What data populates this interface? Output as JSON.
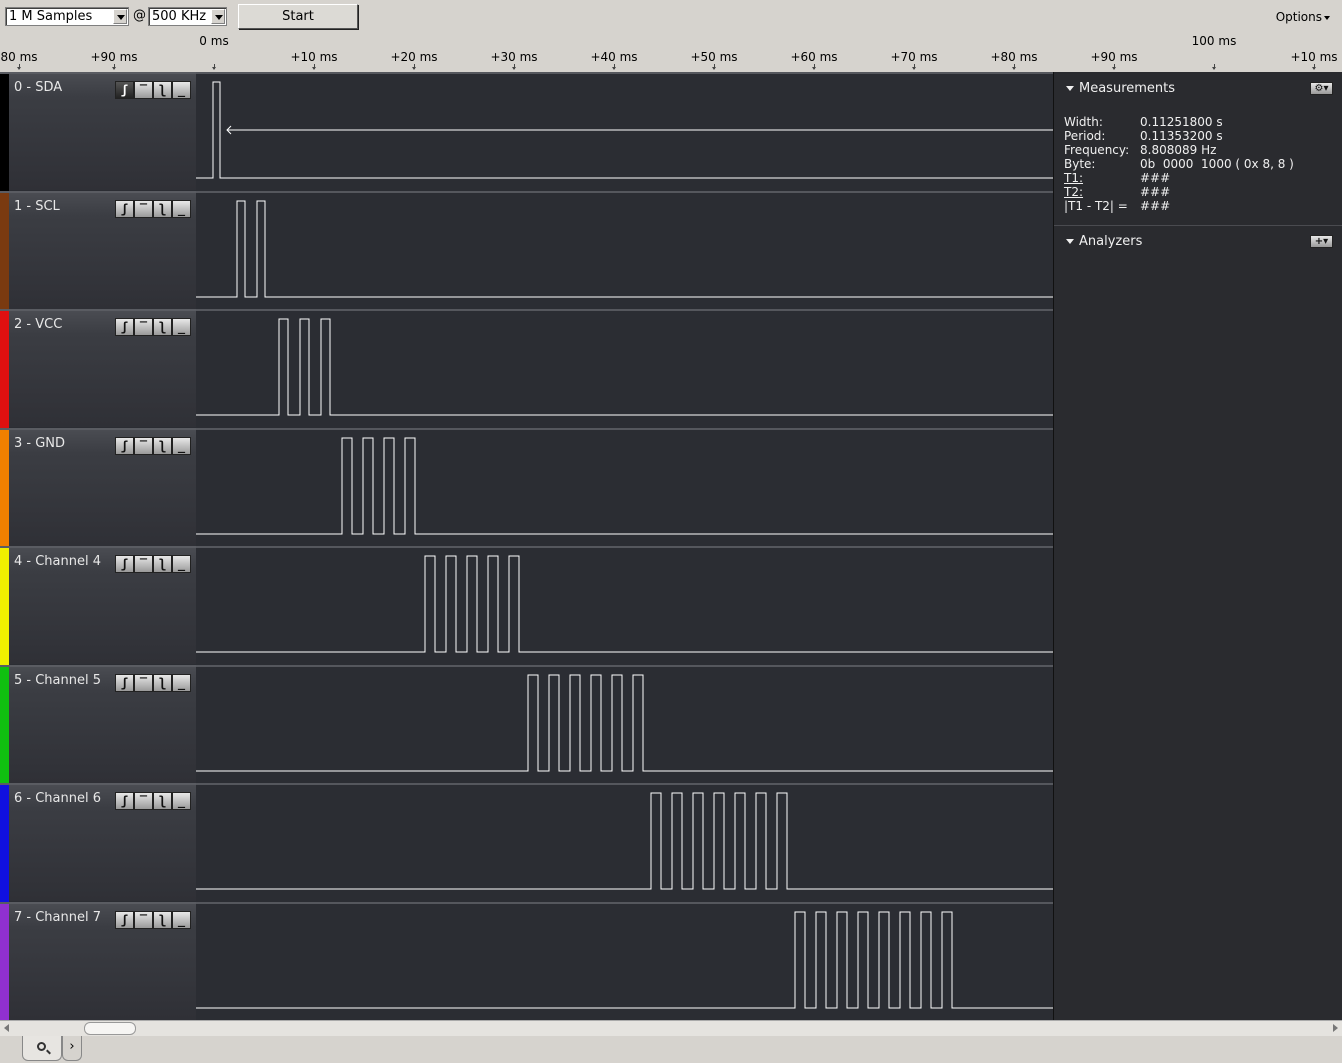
{
  "toolbar": {
    "samples_value": "1 M Samples",
    "at_label": "@",
    "rate_value": "500 KHz",
    "start_label": "Start",
    "options_label": "Options"
  },
  "ruler": {
    "ticks": [
      {
        "label": "80 ms"
      },
      {
        "label": "+90 ms"
      },
      {
        "label": "0 ms"
      },
      {
        "label": "+10 ms"
      },
      {
        "label": "+20 ms"
      },
      {
        "label": "+30 ms"
      },
      {
        "label": "+40 ms"
      },
      {
        "label": "+50 ms"
      },
      {
        "label": "+60 ms"
      },
      {
        "label": "+70 ms"
      },
      {
        "label": "+80 ms"
      },
      {
        "label": "+90 ms"
      },
      {
        "label": "100 ms"
      },
      {
        "label": "+10 ms"
      }
    ]
  },
  "channels": [
    {
      "name": "0 - SDA",
      "color": "#000000",
      "pulses": 1
    },
    {
      "name": "1 - SCL",
      "color": "#7a3a10",
      "pulses": 2
    },
    {
      "name": "2 - VCC",
      "color": "#e01010",
      "pulses": 3
    },
    {
      "name": "3 - GND",
      "color": "#f08000",
      "pulses": 4
    },
    {
      "name": "4 - Channel 4",
      "color": "#f0f000",
      "pulses": 5
    },
    {
      "name": "5 - Channel 5",
      "color": "#10c010",
      "pulses": 6
    },
    {
      "name": "6 - Channel 6",
      "color": "#1010e0",
      "pulses": 7
    },
    {
      "name": "7 - Channel 7",
      "color": "#9030d0",
      "pulses": 8
    }
  ],
  "trigger_buttons": [
    "rising-edge",
    "high-level",
    "falling-edge",
    "low-level"
  ],
  "measurements": {
    "title": "Measurements",
    "rows": [
      {
        "key": "Width:",
        "value": "0.11251800 s"
      },
      {
        "key": "Period:",
        "value": "0.11353200 s"
      },
      {
        "key": "Frequency:",
        "value": "8.808089 Hz"
      },
      {
        "key": "Byte:",
        "value": "0b  0000  1000 ( 0x 8, 8 )"
      },
      {
        "key": "T1:",
        "value": "###"
      },
      {
        "key": "T2:",
        "value": "###"
      },
      {
        "key": "|T1 - T2| =",
        "value": "###"
      }
    ]
  },
  "analyzers": {
    "title": "Analyzers"
  }
}
